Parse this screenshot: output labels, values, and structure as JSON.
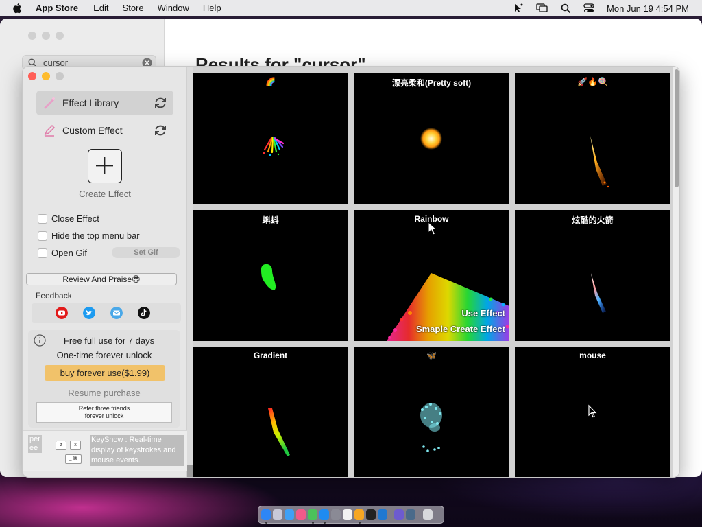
{
  "menubar": {
    "app_name": "App Store",
    "menus": [
      "Edit",
      "Store",
      "Window",
      "Help"
    ],
    "clock": "Mon Jun 19  4:54 PM"
  },
  "back_window": {
    "search_query": "cursor",
    "title": "Results for \"cursor\""
  },
  "sidebar": {
    "nav": [
      {
        "label": "Effect Library",
        "icon": "effect-library-icon"
      },
      {
        "label": "Custom Effect",
        "icon": "pencil-icon"
      }
    ],
    "create_effect_label": "Create Effect",
    "options": [
      {
        "label": "Close Effect",
        "checked": false
      },
      {
        "label": "Hide the top menu bar",
        "checked": false
      },
      {
        "label": "Open Gif",
        "checked": false
      }
    ],
    "set_gif_label": "Set Gif",
    "review_label": "Review And Praise😍",
    "feedback_label": "Feedback",
    "feedback_icons": [
      "youtube-icon",
      "twitter-icon",
      "email-icon",
      "tiktok-icon"
    ],
    "purchase": {
      "free_line": "Free full use for 7 days",
      "unlock_line": "One-time forever unlock",
      "buy_label": "buy forever use($1.99)",
      "resume_label": "Resume purchase",
      "refer_line1": "Refer three friends",
      "refer_line2": "forever unlock"
    },
    "promo": {
      "left_line1": "per",
      "left_line2": "ee",
      "key_labels": [
        "z",
        "x",
        "_",
        "⌘"
      ],
      "text": "KeyShow : Real-time display of keystrokes and mouse events."
    }
  },
  "effects": [
    {
      "title": "🌈",
      "fx": "rainbow-spray"
    },
    {
      "title": "漂亮柔和(Pretty soft)",
      "fx": "glow-orb"
    },
    {
      "title": "🚀🔥🍭",
      "fx": "fire-trail"
    },
    {
      "title": "蝌蚪",
      "fx": "tadpole"
    },
    {
      "title": "Rainbow",
      "fx": "rainbow-cone",
      "actions": [
        "Use Effect",
        "Smaple Create Effect"
      ]
    },
    {
      "title": "炫酷的火箭",
      "fx": "blue-rocket"
    },
    {
      "title": "Gradient",
      "fx": "gradient-trail"
    },
    {
      "title": "🦋",
      "fx": "butterfly-particles"
    },
    {
      "title": "mouse",
      "fx": "mouse-cursor"
    }
  ],
  "colors": {
    "accent_buy": "#f1c26a",
    "close": "#ff5f57",
    "minimize": "#febc2e",
    "zoom": "#c9c9c9"
  }
}
